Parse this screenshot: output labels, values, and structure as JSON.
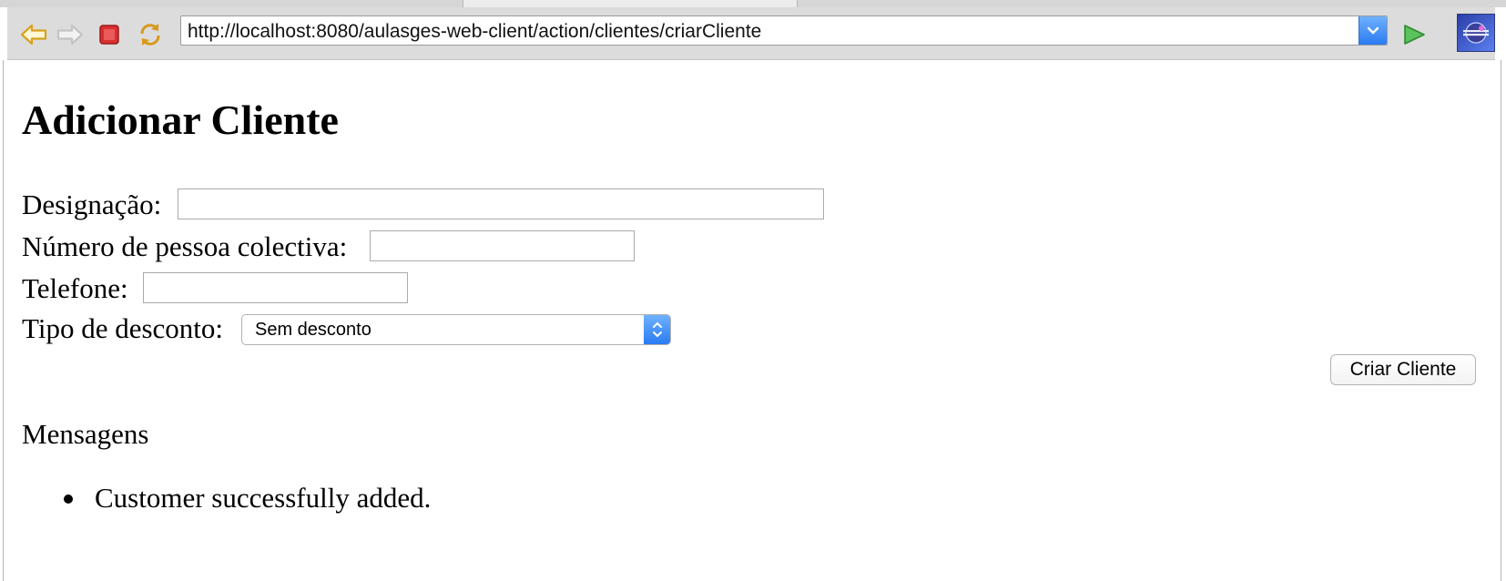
{
  "browser": {
    "url": "http://localhost:8080/aulasges-web-client/action/clientes/criarCliente",
    "buttons": {
      "back_icon": "back-arrow-icon",
      "forward_icon": "forward-arrow-icon",
      "stop_icon": "stop-icon",
      "refresh_icon": "refresh-icon",
      "go_icon": "go-play-icon",
      "extra_icon": "eclipse-icon"
    },
    "colors": {
      "accent_blue": "#2a7bf2",
      "stop_red": "#d93030",
      "go_green": "#3fae3f",
      "arrow_gold": "#e0a020"
    }
  },
  "page": {
    "title": "Adicionar Cliente",
    "form": {
      "designacao_label": "Designação:",
      "designacao_value": "",
      "npc_label": "Número de pessoa colectiva:",
      "npc_value": "",
      "telefone_label": "Telefone:",
      "telefone_value": "",
      "desconto_label": "Tipo de desconto:",
      "desconto_selected": "Sem desconto",
      "submit_label": "Criar Cliente"
    },
    "messages": {
      "heading": "Mensagens",
      "items": [
        "Customer successfully added."
      ]
    }
  }
}
